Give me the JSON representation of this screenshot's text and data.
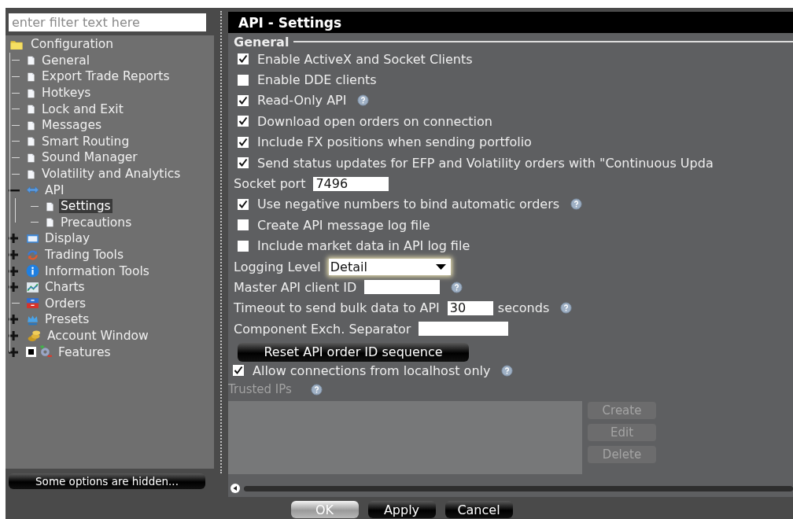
{
  "filter": {
    "placeholder": "enter filter text here"
  },
  "tree": [
    {
      "label": "Configuration",
      "kind": "folder",
      "selected": false,
      "children": [
        {
          "label": "General",
          "kind": "page",
          "selected": false
        },
        {
          "label": "Export Trade Reports",
          "kind": "page",
          "selected": false
        },
        {
          "label": "Hotkeys",
          "kind": "page",
          "selected": false
        },
        {
          "label": "Lock and Exit",
          "kind": "page",
          "selected": false
        },
        {
          "label": "Messages",
          "kind": "page",
          "selected": false
        },
        {
          "label": "Smart Routing",
          "kind": "page",
          "selected": false
        },
        {
          "label": "Sound Manager",
          "kind": "page",
          "selected": false
        },
        {
          "label": "Volatility and Analytics",
          "kind": "page",
          "selected": false
        },
        {
          "label": "API",
          "kind": "api",
          "selected": false,
          "expanded": true,
          "children": [
            {
              "label": "Settings",
              "kind": "page",
              "selected": true
            },
            {
              "label": "Precautions",
              "kind": "page",
              "selected": false
            }
          ]
        },
        {
          "label": "Display",
          "kind": "display",
          "selected": false,
          "expanded": false
        },
        {
          "label": "Trading Tools",
          "kind": "trading",
          "selected": false,
          "expanded": false
        },
        {
          "label": "Information Tools",
          "kind": "info",
          "selected": false,
          "expanded": false
        },
        {
          "label": "Charts",
          "kind": "charts",
          "selected": false,
          "expanded": false
        },
        {
          "label": "Orders",
          "kind": "orders",
          "selected": false
        },
        {
          "label": "Presets",
          "kind": "presets",
          "selected": false,
          "expanded": false
        },
        {
          "label": "Account Window",
          "kind": "account",
          "selected": false,
          "expanded": false
        },
        {
          "label": "Features",
          "kind": "features",
          "selected": false,
          "expanded": false
        }
      ]
    }
  ],
  "hidden_notice": "Some options are hidden...",
  "panel": {
    "title": "API - Settings",
    "section": "General",
    "settings": [
      {
        "kind": "checkbox",
        "label": "Enable ActiveX and Socket Clients",
        "checked": true
      },
      {
        "kind": "checkbox",
        "label": "Enable DDE clients",
        "checked": false
      },
      {
        "kind": "checkbox",
        "label": "Read-Only API",
        "checked": true,
        "help": true
      },
      {
        "kind": "checkbox",
        "label": "Download open orders on connection",
        "checked": true
      },
      {
        "kind": "checkbox",
        "label": "Include FX positions when sending portfolio",
        "checked": true
      },
      {
        "kind": "checkbox",
        "label": "Send status updates for EFP and Volatility orders with \"Continuous Upda",
        "checked": true
      },
      {
        "kind": "field",
        "label": "Socket port",
        "value": "7496"
      },
      {
        "kind": "checkbox",
        "label": "Use negative numbers to bind automatic orders",
        "checked": true,
        "help": true
      },
      {
        "kind": "checkbox",
        "label": "Create API message log file",
        "checked": false
      },
      {
        "kind": "checkbox",
        "label": "Include market data in API log file",
        "checked": false
      },
      {
        "kind": "dropdown",
        "label": "Logging Level",
        "value": "Detail"
      },
      {
        "kind": "field",
        "label": "Master API client ID",
        "help": true
      },
      {
        "kind": "field",
        "label": "Timeout to send bulk data to API",
        "value": "30",
        "suffix": "seconds",
        "help": true
      },
      {
        "kind": "field",
        "label": "Component Exch. Separator"
      },
      {
        "kind": "button",
        "label": "Reset API order ID sequence"
      },
      {
        "kind": "checkbox",
        "label": "Allow connections from localhost only",
        "checked": true,
        "help": true,
        "outdent": true
      }
    ],
    "trusted": {
      "label": "Trusted IPs",
      "disabled": true,
      "help": true,
      "buttons": [
        {
          "label": "Create",
          "disabled": true
        },
        {
          "label": "Edit",
          "disabled": true
        },
        {
          "label": "Delete",
          "disabled": true
        }
      ]
    }
  },
  "footer_buttons": [
    {
      "label": "OK",
      "default": true
    },
    {
      "label": "Apply",
      "default": false
    },
    {
      "label": "Cancel",
      "default": false
    }
  ]
}
